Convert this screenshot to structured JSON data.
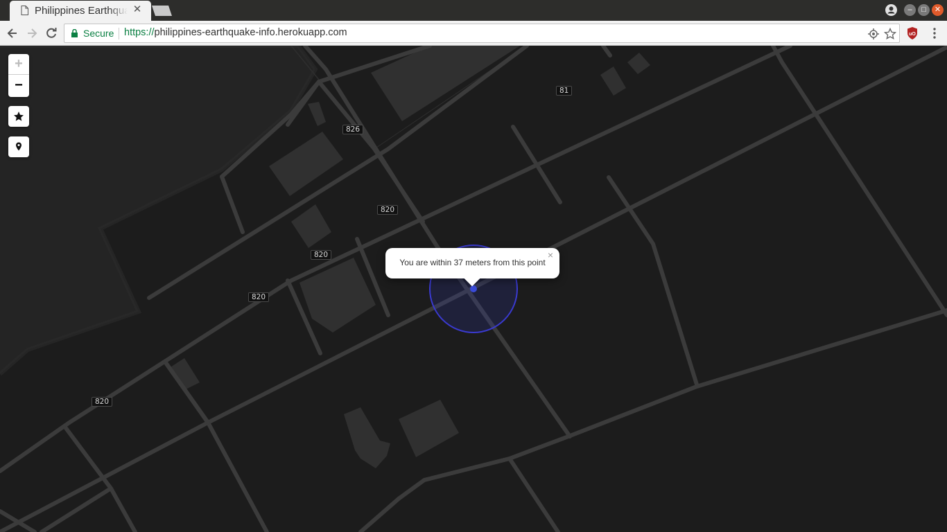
{
  "browser": {
    "tab_title": "Philippines Earthquake Info",
    "security_label": "Secure",
    "url_scheme": "https://",
    "url_host": "philippines-earthquake-info.herokuapp.com"
  },
  "map": {
    "road_labels": [
      "81",
      "826",
      "820",
      "820",
      "820",
      "820"
    ],
    "popup_text": "You are within 37 meters from this point",
    "popup_close": "×",
    "zoom_in_label": "+",
    "zoom_out_label": "−",
    "accuracy_radius_m": 37,
    "colors": {
      "land": "#1c1c1c",
      "road": "#3b3b3b",
      "building": "#2f2f2f",
      "location_marker": "#3a4bd8"
    }
  }
}
